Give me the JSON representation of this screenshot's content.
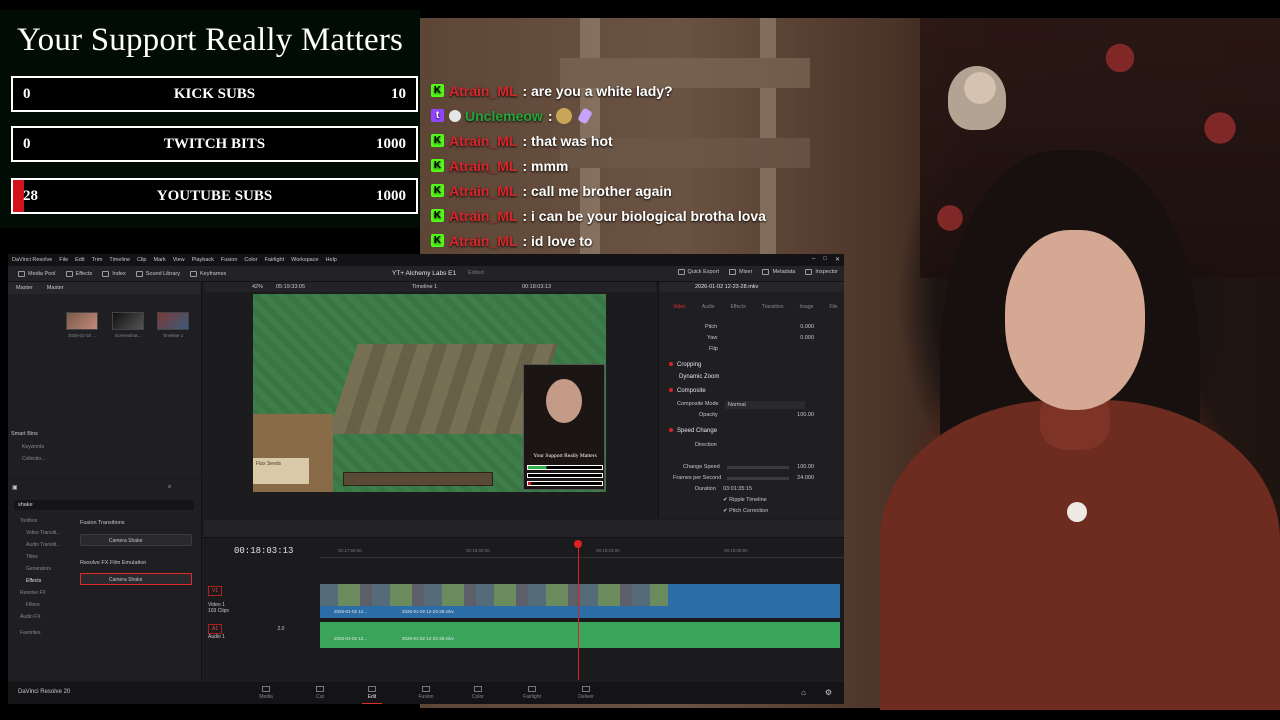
{
  "goals": {
    "title": "Your Support Really Matters",
    "bars": [
      {
        "current": "0",
        "label": "KICK SUBS",
        "max": "10",
        "progress": 0
      },
      {
        "current": "0",
        "label": "TWITCH BITS",
        "max": "1000",
        "progress": 0
      },
      {
        "current": "28",
        "label": "YOUTUBE SUBS",
        "max": "1000",
        "progress": 0.028
      }
    ]
  },
  "chat": {
    "messages": [
      {
        "platform": "kick",
        "user": "Atrain_ML",
        "text": ": are you a white lady?"
      },
      {
        "platform": "twitch",
        "user": "Unclemeow",
        "text": ":"
      },
      {
        "platform": "kick",
        "user": "Atrain_ML",
        "text": ": that was hot"
      },
      {
        "platform": "kick",
        "user": "Atrain_ML",
        "text": ": mmm"
      },
      {
        "platform": "kick",
        "user": "Atrain_ML",
        "text": ": call me brother again"
      },
      {
        "platform": "kick",
        "user": "Atrain_ML",
        "text": ": i can be your biological brotha lova"
      },
      {
        "platform": "kick",
        "user": "Atrain_ML",
        "text": ": id love to"
      }
    ],
    "colors": {
      "kick_user": "#d7262b",
      "twitch_user": "#23a63a",
      "kick": "#53fc18",
      "twitch": "#9146ff"
    }
  },
  "resolve": {
    "menu": [
      "DaVinci Resolve",
      "File",
      "Edit",
      "Trim",
      "Timeline",
      "Clip",
      "Mark",
      "View",
      "Playback",
      "Fusion",
      "Color",
      "Fairlight",
      "Workspace",
      "Help"
    ],
    "toolbar": {
      "media_pool": "Media Pool",
      "effects": "Effects",
      "index": "Index",
      "sound_library": "Sound Library",
      "keyframes": "Keyframes",
      "project_title": "YT+ Alchemy Labs E1",
      "project_status": "Edited",
      "quick_export": "Quick Export",
      "mixer": "Mixer",
      "metadata": "Metadata",
      "inspector": "Inspector"
    },
    "media_pool": {
      "bin": "Master",
      "bin2": "Master",
      "clips": [
        "2026-01-02 ...",
        "Screenshot...",
        "Timeline 1"
      ],
      "smart_bins": "Smart Bins",
      "keywords": "Keywords",
      "collections": "Collectio..."
    },
    "viewer": {
      "zoom": "42%",
      "source_tc": "05:19:33:05",
      "timeline_name": "Timeline 1",
      "tc": "00:18:03:13",
      "game_card": "Flax Seeds",
      "pip_title": "Your Support Really Matters"
    },
    "inspector": {
      "clip_name": "2026-01-02 12-23-28.mkv",
      "tabs": [
        "Video",
        "Audio",
        "Effects",
        "Transition",
        "Image",
        "File"
      ],
      "pitch_label": "Pitch",
      "pitch_value": "0.000",
      "yaw_label": "Yaw",
      "yaw_value": "0.000",
      "flip_label": "Flip",
      "cropping": "Cropping",
      "dynamic_zoom": "Dynamic Zoom",
      "composite": "Composite",
      "composite_mode_label": "Composite Mode",
      "composite_mode_value": "Normal",
      "opacity_label": "Opacity",
      "opacity_value": "100.00",
      "speed_change": "Speed Change",
      "direction_label": "Direction",
      "change_speed_label": "Change Speed",
      "change_speed_value": "100.00",
      "fps_label": "Frames per Second",
      "fps_value": "24.000",
      "duration_label": "Duration",
      "duration_value": "03:01:35:15",
      "ripple": "Ripple Timeline",
      "pitch_correction": "Pitch Correction"
    },
    "effects": {
      "search": "shake",
      "left_items": [
        "Toolbox",
        "Video Transiti...",
        "Audio Transiti...",
        "Titles",
        "Generators",
        "Effects",
        "Resolve FX",
        "Filters",
        "Audio FX",
        "Favorites"
      ],
      "category1": "Fusion Transitions",
      "item1": "Camera Shake",
      "category2": "Resolve FX Film Emulation",
      "item2": "Camera Shake"
    },
    "timeline": {
      "timecode": "00:18:03:13",
      "ruler": [
        "00:17:56:00",
        "00:18:00:00",
        "00:18:04:00",
        "00:18:08:00"
      ],
      "v1_tag": "V1",
      "v1_name": "Video 1",
      "v1_clips": "103 Clips",
      "a1_tag": "A1",
      "a1_name": "Audio 1",
      "a1_level": "2.0",
      "clip_name": "2026-01-02 12...",
      "clip_name_full": "2026-01-02 12-23-28.mkv"
    },
    "pages": [
      "Media",
      "Cut",
      "Edit",
      "Fusion",
      "Color",
      "Fairlight",
      "Deliver"
    ],
    "active_page": "Edit",
    "brand": "DaVinci Resolve 20"
  }
}
